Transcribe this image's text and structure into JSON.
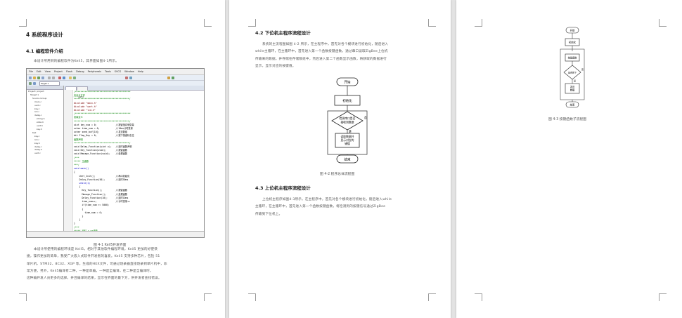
{
  "page1": {
    "chapter_heading": "4 系统程序设计",
    "section_heading": "4.1 编程软件介绍",
    "intro_text": "本设计所用到的编程软件为Keil5，其界面如图4-1所示。",
    "figure_caption": "图 4-1 Keil5开发界面",
    "body_lines": [
      "本设计所使用的编程环境是 Keil5，相对于其他软件编程环境，Keil5 更加的好使快",
      "捷，操作更加的简单，我受广大嵌入式软件开发者的喜爱。Keil5 支持多种芯片，包括 51",
      "单片机、STM32、8C32、XGP 等。生成的HEX文件，可通过烧录器直接烧录到单片机中，非",
      "常方便。另外，Keil5编译有二种，一种是单编，一种是全编译，在二种是全编译时，",
      "这种编开发人员更多的选择，并且编译的结果，显示在界面的最下方，供开发者查找错误。"
    ],
    "ide": {
      "menu": [
        "File",
        "Edit",
        "View",
        "Project",
        "Flash",
        "Debug",
        "Peripherals",
        "Tools",
        "SVCS",
        "Window",
        "Help"
      ],
      "target_name": "Target 1",
      "tree_items": [
        "Project: project",
        "Target 1",
        "Source Group",
        "main.c",
        "uart.c",
        "key.c",
        "lcd.c",
        "delay.c",
        "string.h",
        "stdio.h",
        "uart.h",
        "key.h",
        "Keil",
        "key.c",
        "lcd.c",
        "key.h",
        "delay.c",
        "delay.h",
        "uart.c"
      ],
      "tab_labels": [
        "main.c",
        "uart.c"
      ],
      "code_lines": [
        {
          "t": "/*****************************************",
          "c": "cm"
        },
        {
          "t": "包含头文件",
          "c": "cm"
        },
        {
          "t": "*****************************************/",
          "c": "cm"
        },
        {
          "t": "",
          "c": ""
        },
        {
          "t": "#include \"main.h\"",
          "c": "pp"
        },
        {
          "t": "#include \"uart.h\"",
          "c": "pp"
        },
        {
          "t": "#include \"lcd.h\"",
          "c": "pp"
        },
        {
          "t": "",
          "c": ""
        },
        {
          "t": "/*****************************************",
          "c": "cm"
        },
        {
          "t": "变量定义",
          "c": "cm"
        },
        {
          "t": "*****************************************/",
          "c": "cm"
        },
        {
          "t": "uint key_num = 0;              //按键值存储变量",
          "c": ""
        },
        {
          "t": "uchar time_num = 0;            //10ms计时变量",
          "c": ""
        },
        {
          "t": "uchar send_buf[10];            //发送数组",
          "c": ""
        },
        {
          "t": "bit Flag_Key = 0;              //按下按键标志位",
          "c": ""
        },
        {
          "t": "函数声明",
          "c": "cm"
        },
        {
          "t": "*****************************************/",
          "c": "cm"
        },
        {
          "t": "void Delay_Function(uint x);   //延时函数声明",
          "c": ""
        },
        {
          "t": "void Key_function(void);       //按键函数",
          "c": ""
        },
        {
          "t": "void Manage_Function(void);    //处理函数",
          "c": ""
        },
        {
          "t": "",
          "c": ""
        },
        {
          "t": "/***",
          "c": "cm"
        },
        {
          "t": "***** 主函数",
          "c": "cm"
        },
        {
          "t": "***/",
          "c": "cm"
        },
        {
          "t": "void main()",
          "c": "kw"
        },
        {
          "t": "{",
          "c": ""
        },
        {
          "t": "    Uart_Init();               //串口初始化",
          "c": ""
        },
        {
          "t": "    Delay_Function(50);        //延时50ms",
          "c": ""
        },
        {
          "t": "",
          "c": ""
        },
        {
          "t": "    while(1)",
          "c": "kw"
        },
        {
          "t": "    {",
          "c": ""
        },
        {
          "t": "      Key_function();          //按键函数",
          "c": ""
        },
        {
          "t": "      Manage_Function();       //处理函数",
          "c": ""
        },
        {
          "t": "",
          "c": ""
        },
        {
          "t": "      Delay_Function(10);      //延时10ms",
          "c": ""
        },
        {
          "t": "      time_num++;              //计时变量++",
          "c": ""
        },
        {
          "t": "      if(time_num >= 5000)",
          "c": ""
        },
        {
          "t": "      {",
          "c": ""
        },
        {
          "t": "        time_num = 0;",
          "c": ""
        },
        {
          "t": "      }",
          "c": ""
        },
        {
          "t": "    }",
          "c": ""
        },
        {
          "t": "}",
          "c": ""
        },
        {
          "t": "/***",
          "c": "cm"
        },
        {
          "t": "***** 延时 x ms函数",
          "c": "cm"
        },
        {
          "t": "***/",
          "c": "cm"
        },
        {
          "t": "void Delay_Function(uint x)",
          "c": "kw"
        }
      ]
    }
  },
  "page2": {
    "section_heading_1": "4.2 下位机主程序流程设计",
    "para_1_lines": [
      "系统的主流程图如图 4-2 所示，在主程序中，首先对各个模块进行初始化，随后进入",
      "while主循环，在主循环中，首先进入第一个函数按键函数，通过串口读取ZigBee上位机",
      "传输来的数据，并存储在存储数组中，然后进入第二个函数显示函数，将获取的数据进行",
      "显示，显示对应的按键值。"
    ],
    "flowchart": {
      "start": "开始",
      "init": "初始化",
      "decision_lines": [
        "检测串口是否",
        "接收到数据"
      ],
      "yes": "是",
      "no": "否",
      "process_lines": [
        "读取数据并",
        "显示对应的",
        "键值"
      ],
      "end": "结束"
    },
    "figure_caption": "图 4-2  程序总体流程图",
    "section_heading_2": "4.3 上位机主程序流程设计",
    "para_2_lines": [
      "上位机主程序如图4-3所示，在主程序中，首先对各个模块进行初始化，随后进入while",
      "主循环，在主循环中，首先进入第一个函数按键函数，将检测到的按键信号通过ZigBee",
      "传输到下位机上。"
    ]
  },
  "page3": {
    "flowchart": {
      "start": "开始",
      "init": "初始化",
      "key": "按键函数",
      "decision": "是否按下",
      "yes": "是",
      "no": "否",
      "send_lines": [
        "发送",
        "数据"
      ],
      "end": "结束"
    },
    "figure_caption": "图 4-3  按键函数子流程图"
  }
}
